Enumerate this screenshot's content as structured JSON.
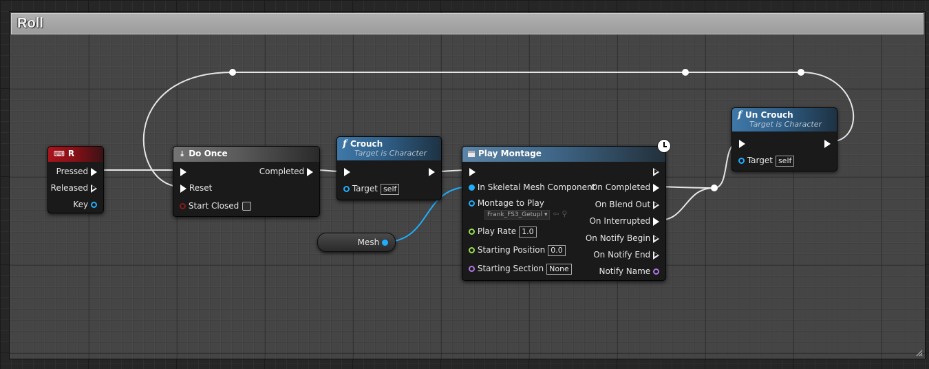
{
  "comment": {
    "title": "Roll"
  },
  "colors": {
    "exec_wire": "#e6e6e6",
    "object_wire": "#1faeff",
    "event_header": "#a7141c",
    "function_header": "#3f78a8"
  },
  "nodes": {
    "input_r": {
      "title": "R",
      "icon": "keyboard-icon",
      "pins": {
        "pressed": "Pressed",
        "released": "Released",
        "key": "Key"
      }
    },
    "do_once": {
      "title": "Do Once",
      "icon": "do-once-icon",
      "pins": {
        "completed": "Completed",
        "reset": "Reset",
        "start_closed": "Start Closed"
      }
    },
    "crouch": {
      "title": "Crouch",
      "subtitle": "Target is Character",
      "icon": "function-icon",
      "pins": {
        "target": "Target",
        "target_value": "self"
      }
    },
    "play_montage": {
      "title": "Play Montage",
      "icon": "montage-icon",
      "pins": {
        "in_skeletal_mesh": "In Skeletal Mesh Component",
        "montage_to_play": "Montage to Play",
        "montage_value": "Frank_FS3_Getupl",
        "play_rate": "Play Rate",
        "play_rate_value": "1.0",
        "starting_position": "Starting Position",
        "starting_position_value": "0.0",
        "starting_section": "Starting Section",
        "starting_section_value": "None",
        "on_completed": "On Completed",
        "on_blend_out": "On Blend Out",
        "on_interrupted": "On Interrupted",
        "on_notify_begin": "On Notify Begin",
        "on_notify_end": "On Notify End",
        "notify_name": "Notify Name"
      }
    },
    "un_crouch": {
      "title": "Un Crouch",
      "subtitle": "Target is Character",
      "icon": "function-icon",
      "pins": {
        "target": "Target",
        "target_value": "self"
      }
    },
    "mesh_var": {
      "label": "Mesh"
    }
  }
}
